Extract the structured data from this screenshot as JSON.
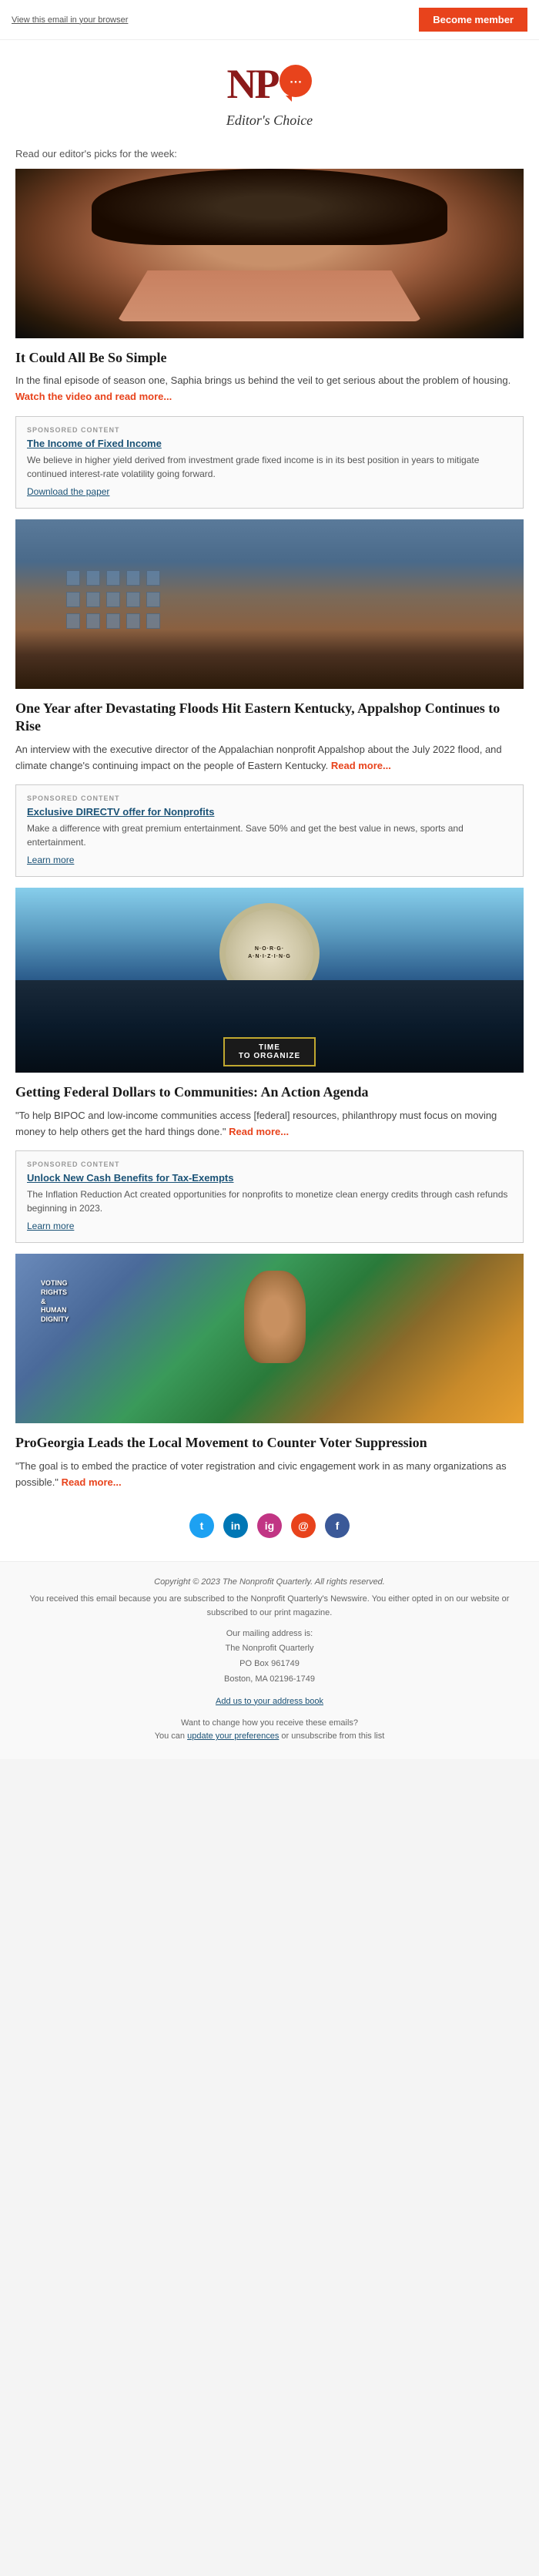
{
  "topbar": {
    "view_browser": "View this email in your browser",
    "become_member": "Become member"
  },
  "header": {
    "logo_text": "NP",
    "tagline": "Editor's Choice"
  },
  "intro": {
    "text": "Read our editor's picks for the week:"
  },
  "articles": [
    {
      "id": "article1",
      "title": "It Could All Be So Simple",
      "body": "In the final episode of season one, Saphia brings us behind the veil to get serious about the problem of housing.",
      "read_more": "Watch the video and read more...",
      "image_alt": "Woman with curly hair gesturing expressively"
    },
    {
      "id": "article2",
      "title": "One Year after Devastating Floods Hit Eastern Kentucky, Appalshop Continues to Rise",
      "body": "An interview with the executive director of the Appalachian nonprofit Appalshop about the July 2022 flood, and climate change's continuing impact on the people of Eastern Kentucky.",
      "read_more": "Read more...",
      "image_alt": "Flood damaged brick building"
    },
    {
      "id": "article3",
      "title": "Getting Federal Dollars to Communities: An Action Agenda",
      "body": "\"To help BIPOC and low-income communities access [federal] resources, philanthropy must focus on moving money to help others get the hard things done.\"",
      "read_more": "Read more...",
      "image_alt": "Clock against city skyline with TIME TO ORGANIZE sign"
    },
    {
      "id": "article4",
      "title": "ProGeorgia Leads the Local Movement to Counter Voter Suppression",
      "body": "\"The goal is to embed the practice of voter registration and civic engagement work in as many organizations as possible.\"",
      "read_more": "Read more...",
      "image_alt": "Colorful mural with voting rights imagery"
    }
  ],
  "sponsored": [
    {
      "id": "sponsored1",
      "label": "SPONSORED CONTENT",
      "title": "The Income of Fixed Income",
      "body": "We believe in higher yield derived from investment grade fixed income is in its best position in years to mitigate continued interest-rate volatility going forward.",
      "link": "Download the paper"
    },
    {
      "id": "sponsored2",
      "label": "SPONSORED CONTENT",
      "title": "Exclusive DIRECTV offer for Nonprofits",
      "body": "Make a difference with great premium entertainment. Save 50% and get the best value in news, sports and entertainment.",
      "link": "Learn more"
    },
    {
      "id": "sponsored3",
      "label": "SPONSORED CONTENT",
      "title": "Unlock New Cash Benefits for Tax-Exempts",
      "body": "The Inflation Reduction Act created opportunities for nonprofits to monetize clean energy credits through cash refunds beginning in 2023.",
      "link": "Learn more"
    }
  ],
  "social": {
    "icons": [
      {
        "name": "twitter",
        "label": "t",
        "color": "#1da1f2"
      },
      {
        "name": "linkedin",
        "label": "in",
        "color": "#0077b5"
      },
      {
        "name": "instagram",
        "label": "ig",
        "color": "#c13584"
      },
      {
        "name": "email",
        "label": "@",
        "color": "#e8431c"
      },
      {
        "name": "facebook",
        "label": "f",
        "color": "#3b5998"
      }
    ]
  },
  "footer": {
    "copyright": "Copyright © 2023 The Nonprofit Quarterly. All rights reserved.",
    "received_text": "You received this email because you are subscribed to the Nonprofit Quarterly's Newswire. You either opted in on our website or subscribed to our print magazine.",
    "mailing_label": "Our mailing address is:",
    "org_name": "The Nonprofit Quarterly",
    "po_box": "PO Box 961749",
    "city": "Boston, MA 02196-1749",
    "add_address": "Add us to your address book",
    "change_text": "Want to change how you receive these emails?",
    "update_text": "You can",
    "update_link": "update your preferences",
    "or_text": "or unsubscribe from this list"
  }
}
